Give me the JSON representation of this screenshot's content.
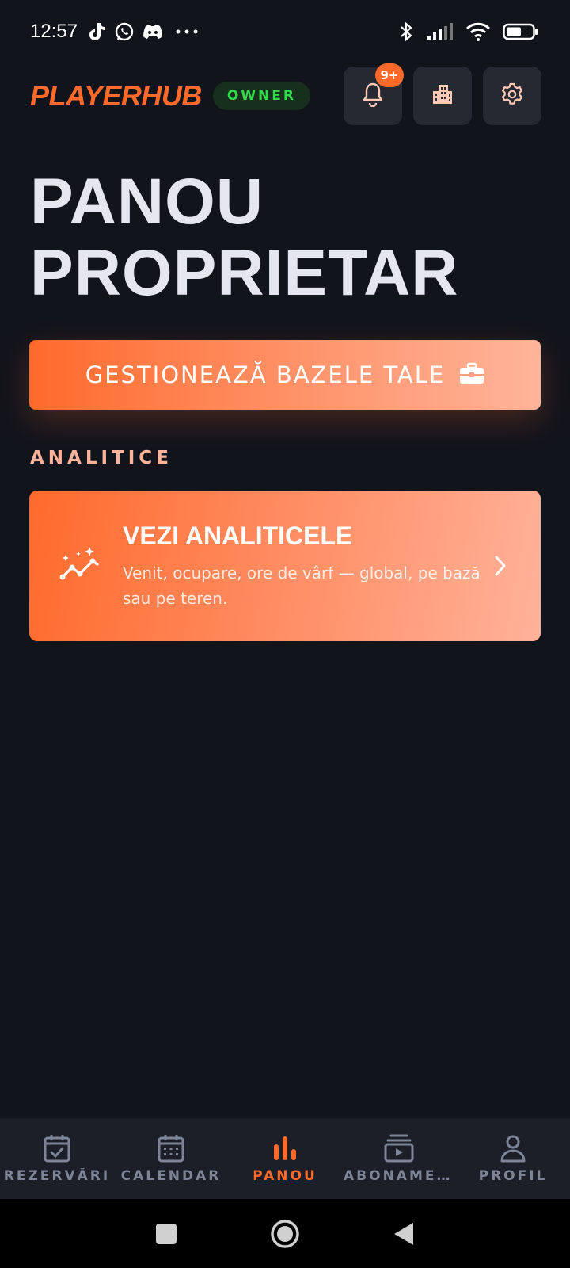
{
  "status_bar": {
    "time": "12:57",
    "icons_left": [
      "tiktok-icon",
      "whatsapp-icon",
      "discord-icon",
      "more-dots-icon"
    ],
    "icons_right": [
      "bluetooth-icon",
      "signal-icon",
      "wifi-icon",
      "battery-icon"
    ]
  },
  "header": {
    "brand": "PLAYERHUB",
    "role_badge": "OWNER",
    "notifications_count": "9+"
  },
  "page": {
    "title_line1": "PANOU",
    "title_line2": "PROPRIETAR"
  },
  "manage_button": {
    "label": "GESTIONEAZĂ BAZELE TALE"
  },
  "analytics": {
    "section_label": "ANALITICE",
    "card_title": "VEZI ANALITICELE",
    "card_description": "Venit, ocupare, ore de vârf — global, pe bază sau pe teren."
  },
  "bottom_nav": {
    "items": [
      {
        "label": "REZERVĂRI",
        "icon": "calendar-check-icon"
      },
      {
        "label": "CALENDAR",
        "icon": "calendar-grid-icon"
      },
      {
        "label": "PANOU",
        "icon": "bar-chart-icon"
      },
      {
        "label": "ABONAMEN…",
        "icon": "subscriptions-icon"
      },
      {
        "label": "PROFIL",
        "icon": "user-icon"
      }
    ],
    "active_index": 2
  },
  "colors": {
    "accent": "#ff6a2b",
    "background": "#12141c",
    "owner_badge_text": "#35d94d",
    "section_label": "#ffb29a",
    "nav_inactive": "#7d8597"
  }
}
